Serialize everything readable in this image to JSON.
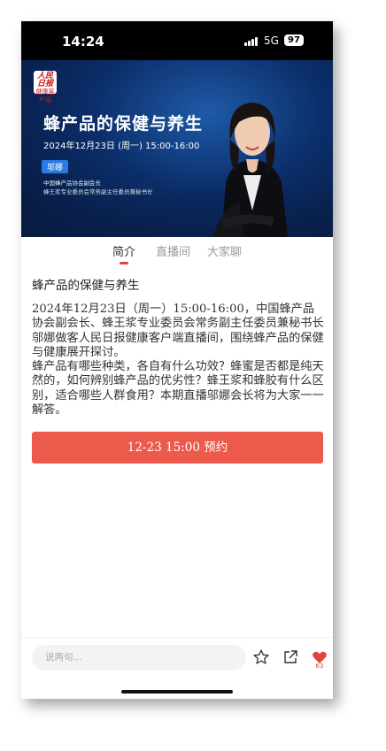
{
  "status_bar": {
    "time": "14:24",
    "network": "5G",
    "battery": "97"
  },
  "banner": {
    "logo_text": "人民日报",
    "logo_sub": "健康客户端",
    "title": "蜂产品的保健与养生",
    "datetime": "2024年12月23日 (周一) 15:00-16:00",
    "speaker_name": "邬娜",
    "speaker_role_1": "中国蜂产品协会副会长",
    "speaker_role_2": "蜂王浆专业委员会常务副主任委员兼秘书长"
  },
  "tabs": [
    "简介",
    "直播间",
    "大家聊"
  ],
  "active_tab": "简介",
  "content": {
    "title": "蜂产品的保健与养生",
    "paragraph_1": "2024年12月23日（周一）15:00-16:00，中国蜂产品协会副会长、蜂王浆专业委员会常务副主任委员兼秘书长邬娜做客人民日报健康客户端直播间，围绕蜂产品的保健与健康展开探讨。",
    "paragraph_2": "蜂产品有哪些种类，各自有什么功效？蜂蜜是否都是纯天然的，如何辨别蜂产品的优劣性？蜂王浆和蜂胶有什么区别，适合哪些人群食用？本期直播邬娜会长将为大家一一解答。"
  },
  "reserve_button": "12-23  15:00  预约",
  "bottom_bar": {
    "comment_placeholder": "说两句...",
    "like_count": "63"
  },
  "colors": {
    "accent": "#ec5a4c",
    "banner_dark": "#061638",
    "banner_blue": "#1e5aa8"
  },
  "icons": [
    "star-icon",
    "share-icon",
    "heart-icon"
  ]
}
